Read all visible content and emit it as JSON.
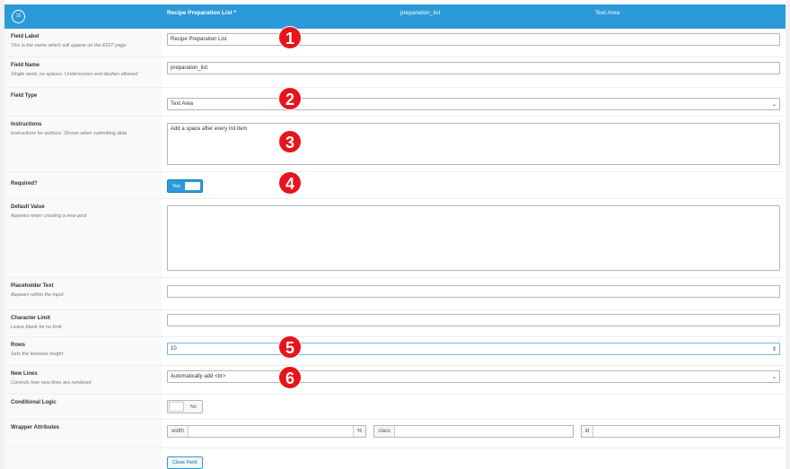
{
  "header": {
    "order": "10",
    "label": "Recipe Preparation List *",
    "name": "preparation_list",
    "type": "Text Area",
    "color": "#2b9ad8"
  },
  "fields": {
    "label": {
      "title": "Field Label",
      "desc": "This is the name which will appear on the EDIT page",
      "value": "Recipe Preparation List"
    },
    "name": {
      "title": "Field Name",
      "desc": "Single word, no spaces. Underscores and dashes allowed",
      "value": "preparation_list"
    },
    "type": {
      "title": "Field Type",
      "value": "Text Area"
    },
    "instructions": {
      "title": "Instructions",
      "desc": "Instructions for authors. Shown when submitting data",
      "value": "Add a space after every list item"
    },
    "required": {
      "title": "Required?",
      "value": "Yes"
    },
    "default": {
      "title": "Default Value",
      "desc": "Appears when creating a new post",
      "value": ""
    },
    "placeholder": {
      "title": "Placeholder Text",
      "desc": "Appears within the input",
      "value": ""
    },
    "charlimit": {
      "title": "Character Limit",
      "desc": "Leave blank for no limit",
      "value": ""
    },
    "rows": {
      "title": "Rows",
      "desc": "Sets the textarea height",
      "value": "10"
    },
    "newlines": {
      "title": "New Lines",
      "desc": "Controls how new lines are rendered",
      "value": "Automatically add <br>"
    },
    "conditional": {
      "title": "Conditional Logic",
      "value": "No"
    },
    "wrapper": {
      "title": "Wrapper Attributes",
      "width": "width",
      "percent": "%",
      "class": "class",
      "id": "id"
    }
  },
  "close_label": "Close Field",
  "markers": [
    "1",
    "2",
    "3",
    "4",
    "5",
    "6"
  ]
}
